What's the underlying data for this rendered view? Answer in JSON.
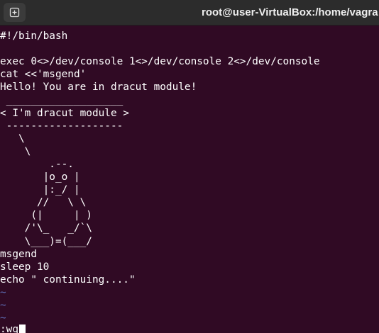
{
  "window": {
    "title": "root@user-VirtualBox:/home/vagra",
    "new_tab_icon": "new-tab-plus-icon"
  },
  "editor": {
    "lines": [
      "#!/bin/bash",
      "",
      "exec 0<>/dev/console 1<>/dev/console 2<>/dev/console",
      "cat <<'msgend'",
      "Hello! You are in dracut module!",
      " ___________________",
      "< I'm dracut module >",
      " -------------------",
      "   \\",
      "    \\",
      "        .--.",
      "       |o_o |",
      "       |:_/ |",
      "      //   \\ \\",
      "     (|     | )",
      "    /'\\_   _/`\\",
      "    \\___)=(___/",
      "msgend",
      "sleep 10",
      "echo \" continuing....\""
    ],
    "tilde_lines": [
      "~",
      "~",
      "~"
    ],
    "command": ":wq"
  },
  "colors": {
    "background": "#300a24",
    "titlebar": "#2c2c2c",
    "text": "#ffffff",
    "tilde": "#5f6fb8"
  }
}
